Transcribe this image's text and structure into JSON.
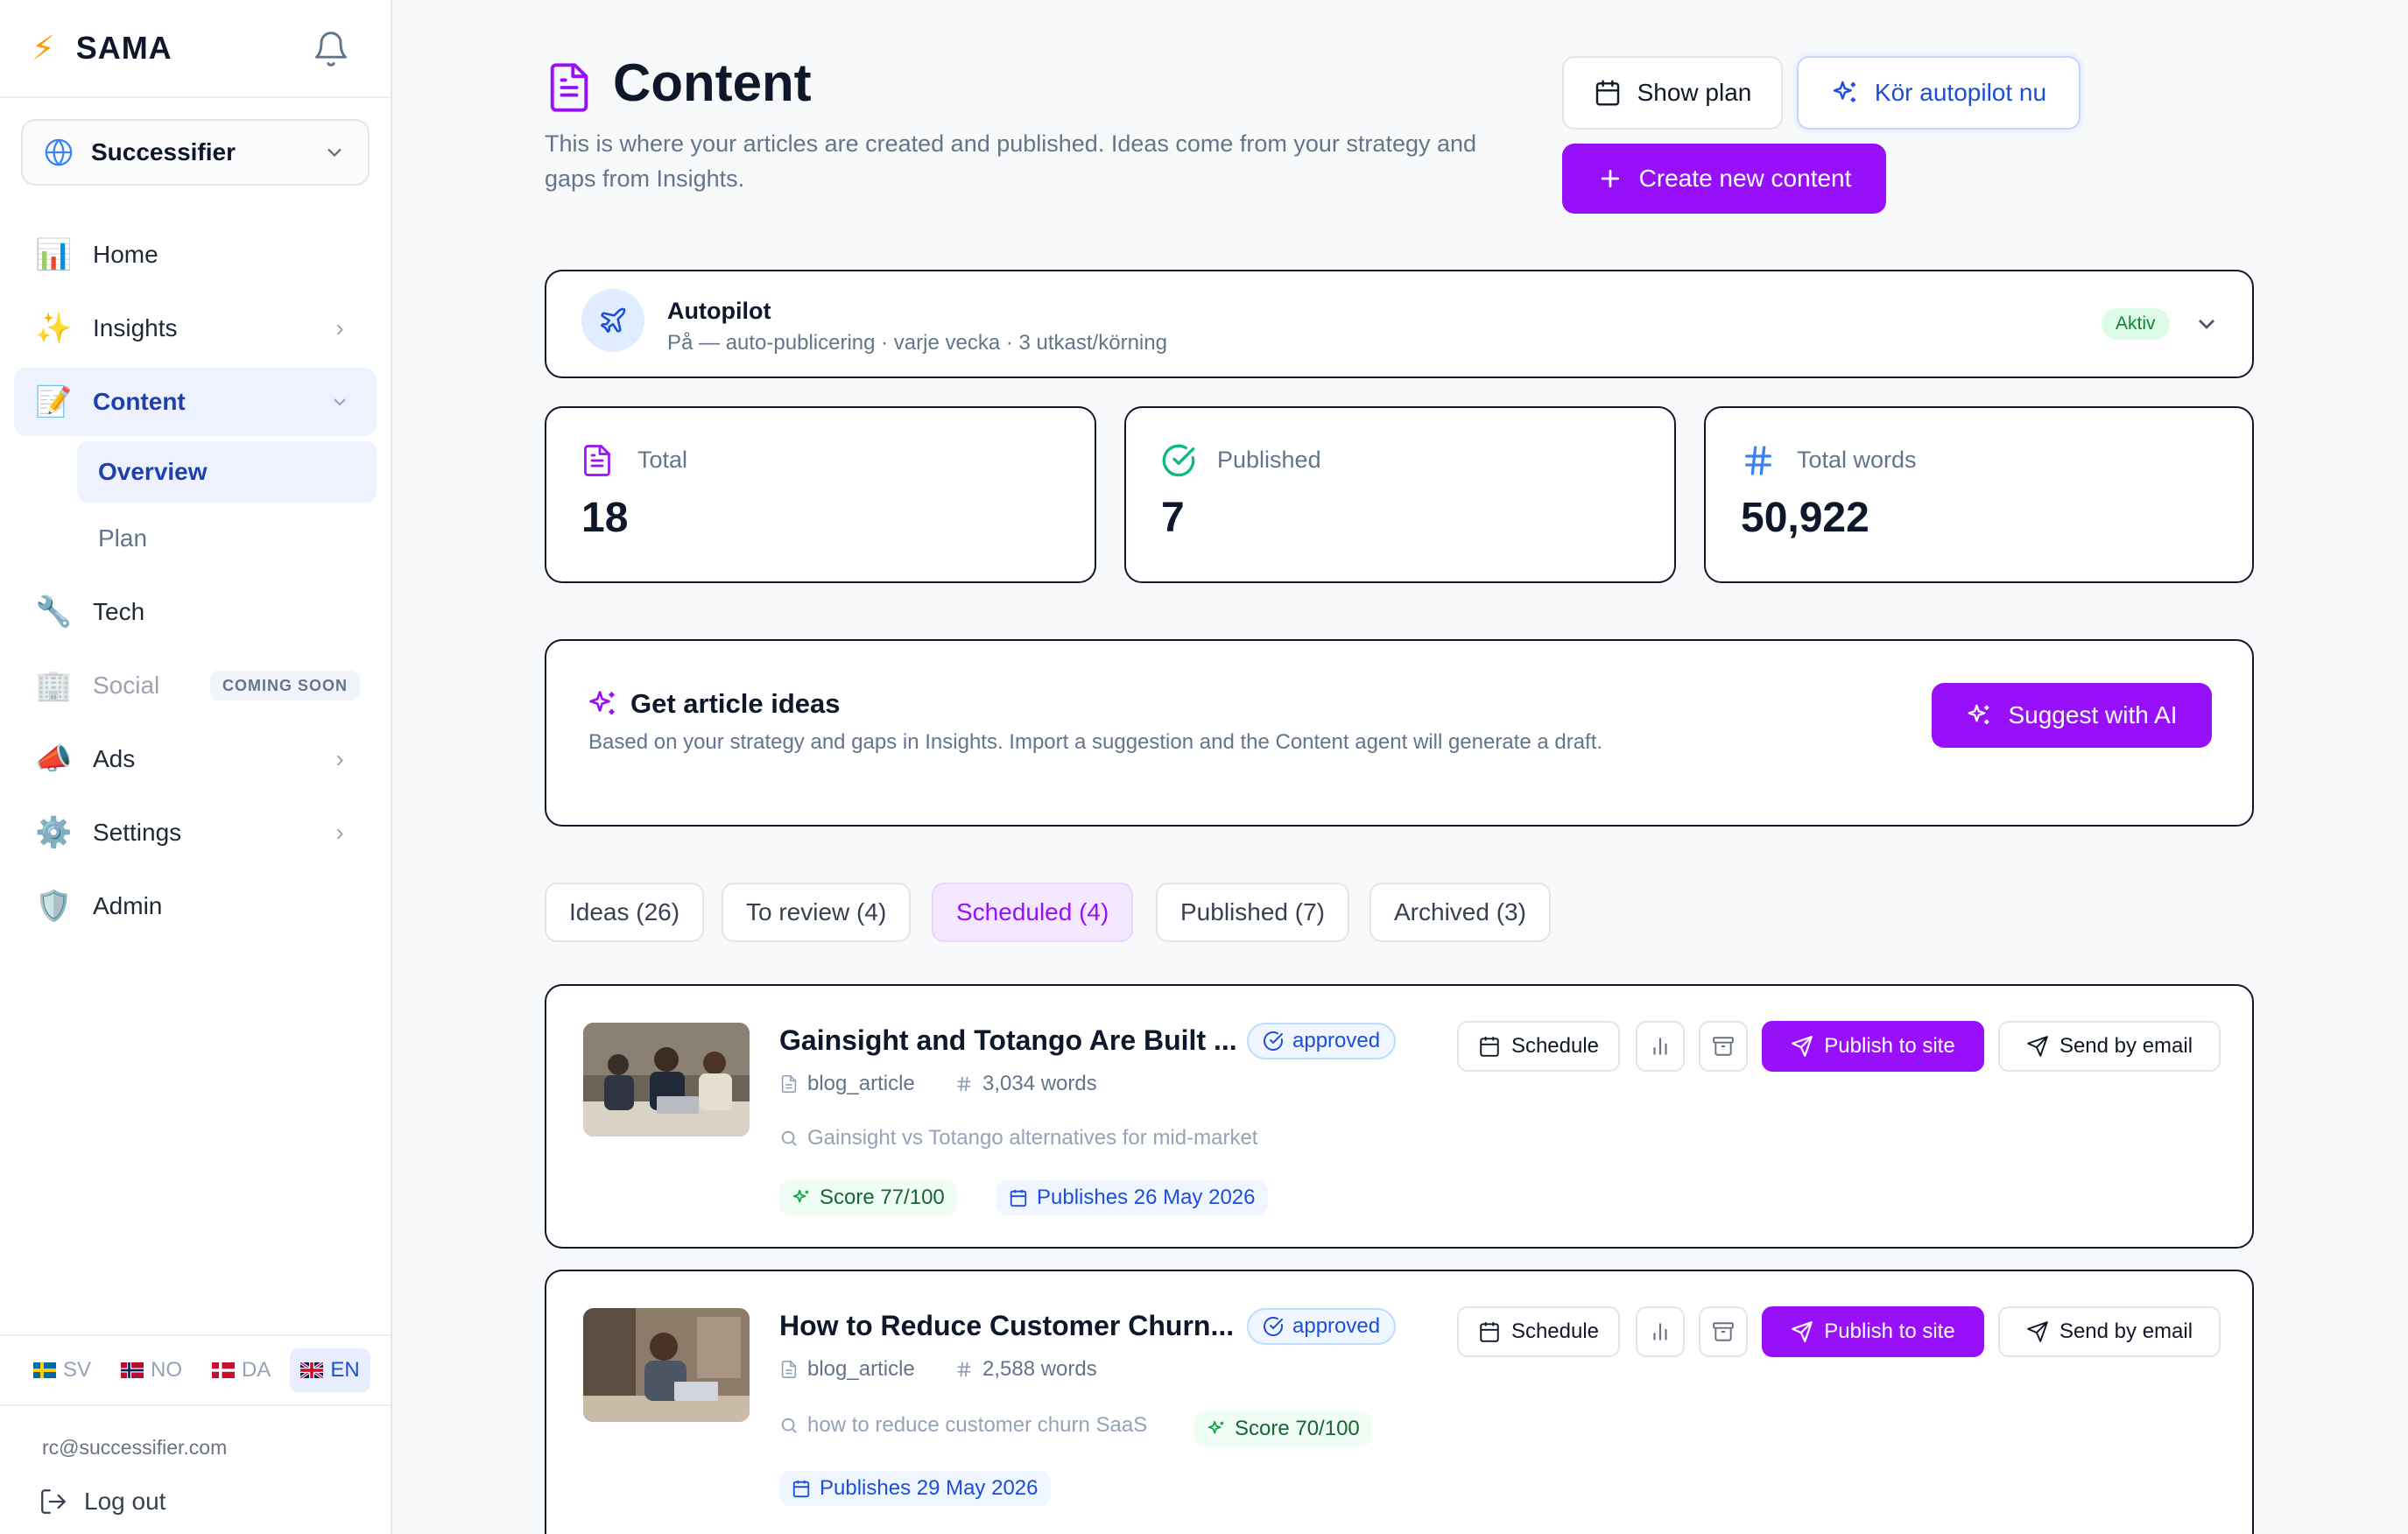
{
  "app": {
    "name": "SAMA"
  },
  "workspace": {
    "name": "Successifier"
  },
  "nav": {
    "home": "Home",
    "insights": "Insights",
    "content": "Content",
    "content_sub": {
      "overview": "Overview",
      "plan": "Plan"
    },
    "tech": "Tech",
    "social": "Social",
    "coming_soon": "COMING SOON",
    "ads": "Ads",
    "settings": "Settings",
    "admin": "Admin"
  },
  "languages": [
    {
      "code": "SV",
      "active": false
    },
    {
      "code": "NO",
      "active": false
    },
    {
      "code": "DA",
      "active": false
    },
    {
      "code": "EN",
      "active": true
    }
  ],
  "user": {
    "email": "rc@successifier.com",
    "logout": "Log out"
  },
  "page": {
    "title": "Content",
    "description": "This is where your articles are created and published. Ideas come from your strategy and gaps from Insights."
  },
  "header_buttons": {
    "show_plan": "Show plan",
    "run_autopilot": "Kör autopilot nu",
    "create_new": "Create new content"
  },
  "autopilot": {
    "title": "Autopilot",
    "subtitle": "På — auto-publicering · varje vecka · 3 utkast/körning",
    "status": "Aktiv"
  },
  "stats": {
    "total": {
      "label": "Total",
      "value": "18"
    },
    "published": {
      "label": "Published",
      "value": "7"
    },
    "words": {
      "label": "Total words",
      "value": "50,922"
    }
  },
  "ideas": {
    "title": "Get article ideas",
    "description": "Based on your strategy and gaps in Insights. Import a suggestion and the Content agent will generate a draft.",
    "button": "Suggest with AI"
  },
  "tabs": [
    {
      "label": "Ideas (26)",
      "active": false
    },
    {
      "label": "To review (4)",
      "active": false
    },
    {
      "label": "Scheduled (4)",
      "active": true
    },
    {
      "label": "Published (7)",
      "active": false
    },
    {
      "label": "Archived (3)",
      "active": false
    }
  ],
  "article_actions": {
    "schedule": "Schedule",
    "publish": "Publish to site",
    "email": "Send by email"
  },
  "articles": [
    {
      "title": "Gainsight and Totango Are Built ...",
      "status": "approved",
      "type": "blog_article",
      "words": "3,034 words",
      "keyword": "Gainsight vs Totango alternatives for mid-market",
      "score": "Score 77/100",
      "publish_date": "Publishes 26 May 2026"
    },
    {
      "title": "How to Reduce Customer Churn...",
      "status": "approved",
      "type": "blog_article",
      "words": "2,588 words",
      "keyword": "how to reduce customer churn SaaS",
      "score": "Score 70/100",
      "publish_date": "Publishes 29 May 2026"
    }
  ],
  "colors": {
    "primary": "#9810fa",
    "active_nav": "#1e40af",
    "approved": "#1d4ed8",
    "score_green": "#166534"
  }
}
